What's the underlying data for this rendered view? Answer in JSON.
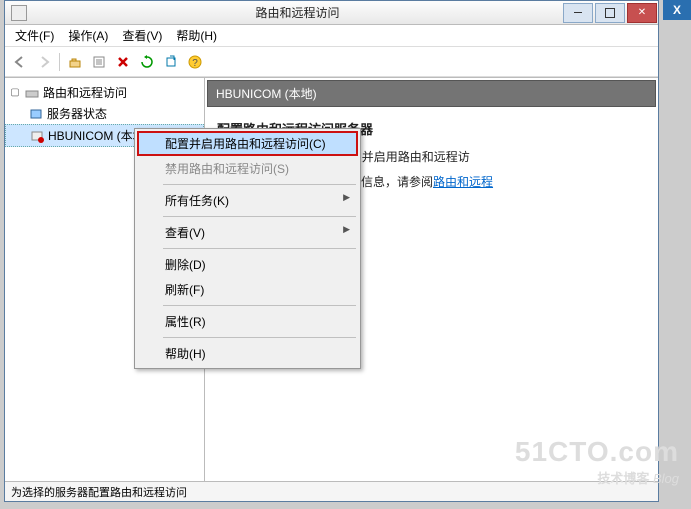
{
  "titlebar": {
    "title": "路由和远程访问"
  },
  "menubar": {
    "file": "文件(F)",
    "action": "操作(A)",
    "view": "查看(V)",
    "help": "帮助(H)"
  },
  "tree": {
    "root": "路由和远程访问",
    "server_status": "服务器状态",
    "node": "HBUNICOM (本地)"
  },
  "content": {
    "header": "HBUNICOM (本地)",
    "heading": "配置路由和远程访问服务器",
    "line1_a": "请在\"操作\"菜单上单击\"配置并启用路由和远程访",
    "line2_a": "部署情况及疑难解答的详细信息，请参阅",
    "line2_link": "路由和远程"
  },
  "contextmenu": {
    "configure": "配置并启用路由和远程访问(C)",
    "disable": "禁用路由和远程访问(S)",
    "all_tasks": "所有任务(K)",
    "view": "查看(V)",
    "delete": "删除(D)",
    "refresh": "刷新(F)",
    "properties": "属性(R)",
    "help": "帮助(H)"
  },
  "statusbar": {
    "text": "为选择的服务器配置路由和远程访问"
  },
  "watermark": {
    "big": "51CTO.com",
    "small": "技术博客",
    "blog": "Blog"
  },
  "rightstrip": {
    "x": "X"
  }
}
